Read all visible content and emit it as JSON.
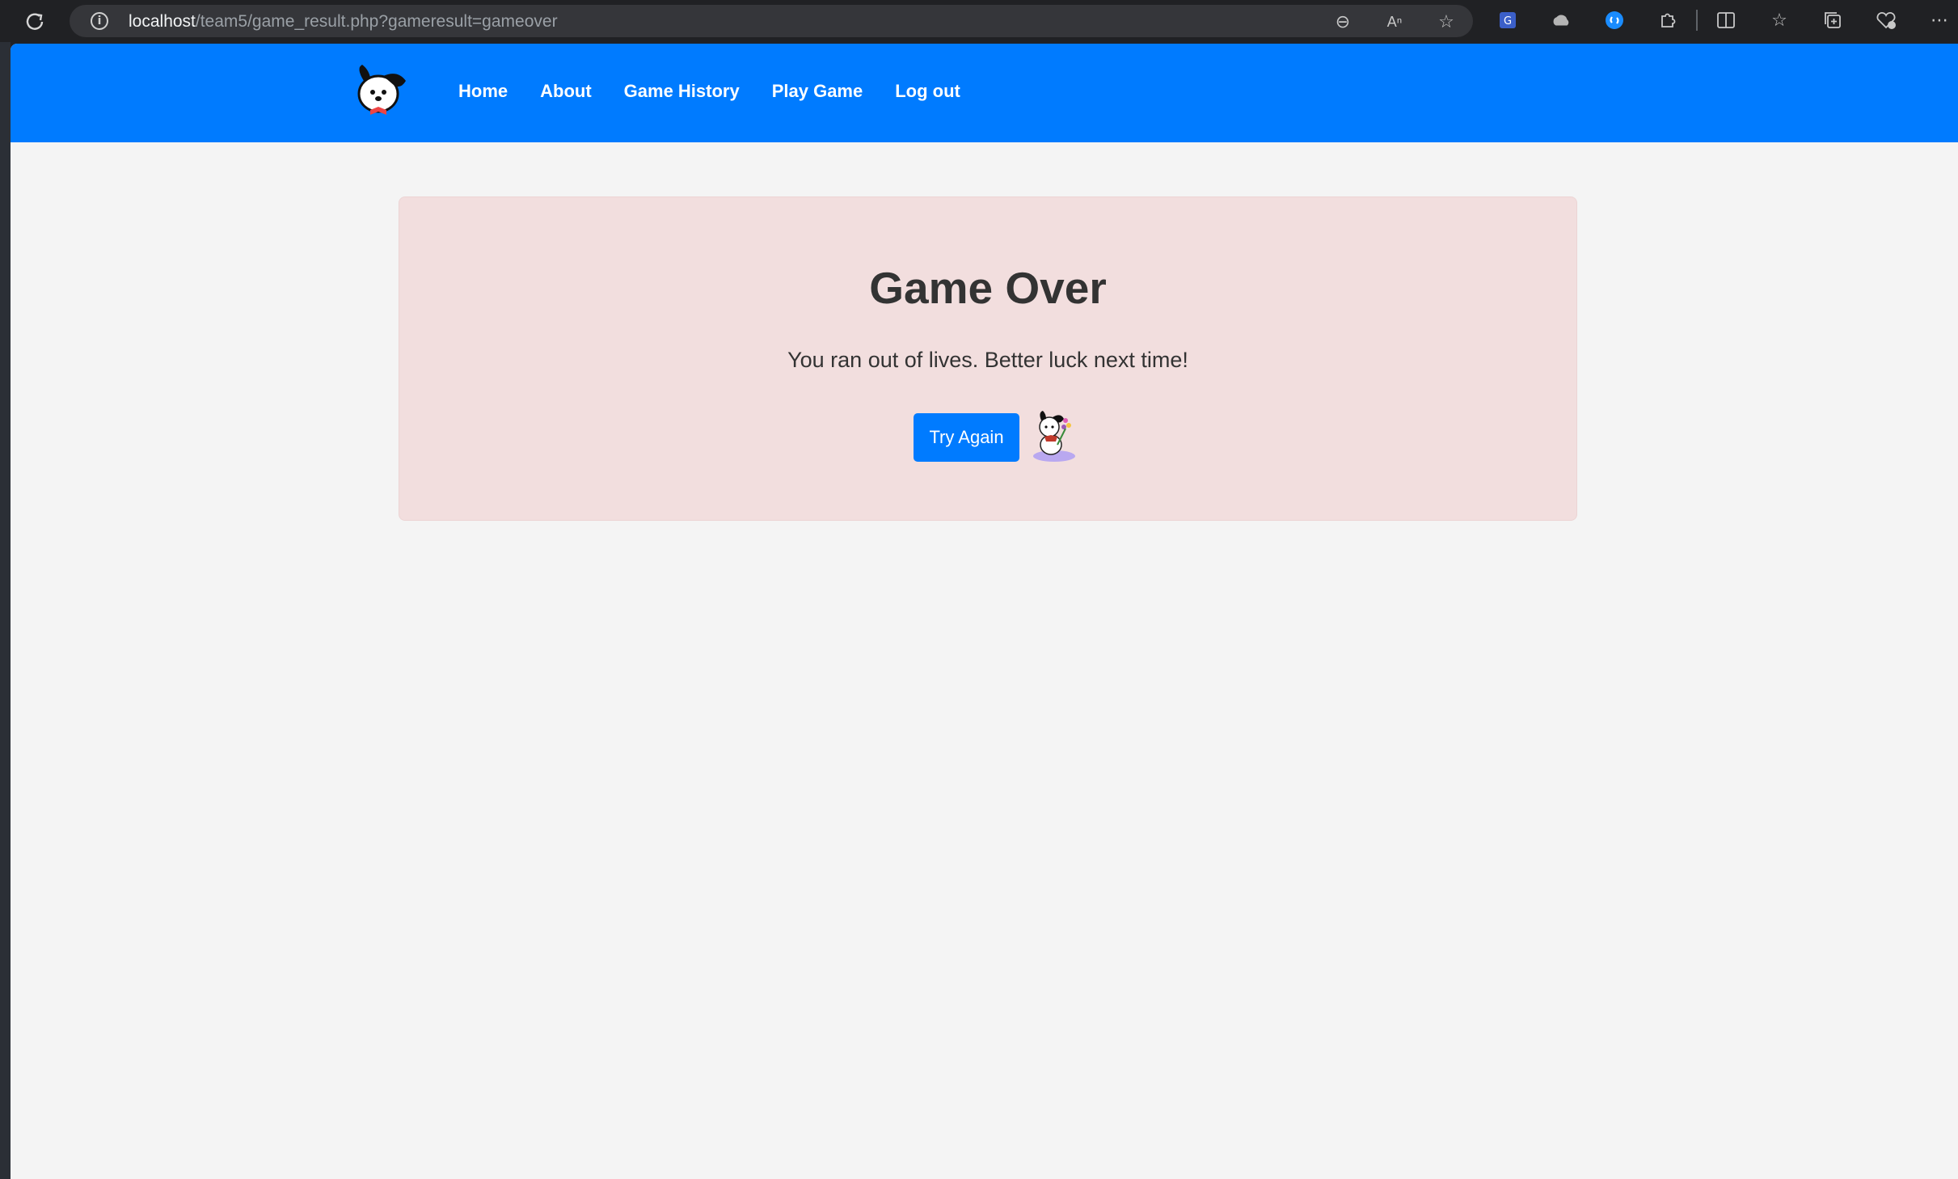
{
  "browser": {
    "url_host": "localhost",
    "url_path": "/team5/game_result.php?gameresult=gameover"
  },
  "nav": {
    "items": [
      "Home",
      "About",
      "Game History",
      "Play Game",
      "Log out"
    ]
  },
  "result": {
    "title": "Game Over",
    "message": "You ran out of lives. Better luck next time!",
    "button_label": "Try Again"
  },
  "colors": {
    "navbar": "#007bff",
    "card_bg": "#f2dede",
    "button": "#007bff",
    "page_bg": "#f4f4f4"
  },
  "icons": {
    "logo": "dog-face-logo",
    "mascot": "dog-with-flower-mascot"
  }
}
